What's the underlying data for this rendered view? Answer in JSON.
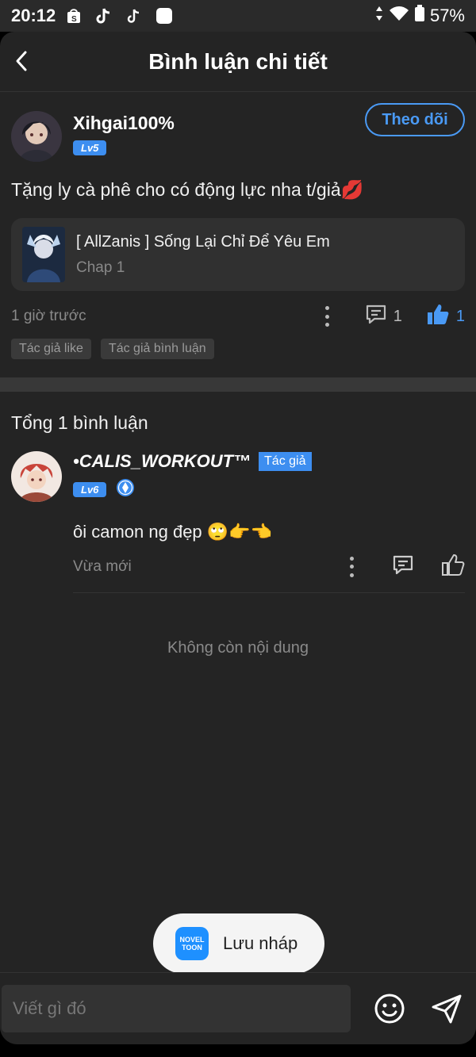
{
  "status_bar": {
    "time": "20:12",
    "battery": "57%",
    "notification_icons": [
      "shopee-icon",
      "tiktok-icon",
      "tiktok-lite-icon",
      "square-app-icon"
    ]
  },
  "header": {
    "title": "Bình luận chi tiết",
    "back_icon": "chevron-left-icon"
  },
  "post": {
    "username": "Xihgai100%",
    "level": "Lv5",
    "follow_label": "Theo dõi",
    "content": "Tặng ly cà phê cho có động lực nha t/giả💋",
    "work": {
      "title": "[ AllZanis ] Sống Lại Chỉ Để Yêu Em",
      "chapter": "Chap 1"
    },
    "time": "1 giờ trước",
    "reply_count": "1",
    "like_count": "1",
    "tags": [
      "Tác giả like",
      "Tác giả bình luận"
    ]
  },
  "comments": {
    "total_label": "Tổng 1 bình luận",
    "items": [
      {
        "username": "•CALIS_WORKOUT™",
        "author_badge": "Tác giả",
        "level": "Lv6",
        "text": "ôi camon ng đẹp",
        "emojis": "🙄👉👈",
        "time": "Vừa mới"
      }
    ],
    "end_label": "Không còn nội dung"
  },
  "toast": {
    "logo_line1": "NOVEL",
    "logo_line2": "TOON",
    "text": "Lưu nháp"
  },
  "composer": {
    "placeholder": "Viết gì đó"
  },
  "colors": {
    "accent": "#3d8ef0",
    "background": "#242424",
    "card": "#303030"
  }
}
